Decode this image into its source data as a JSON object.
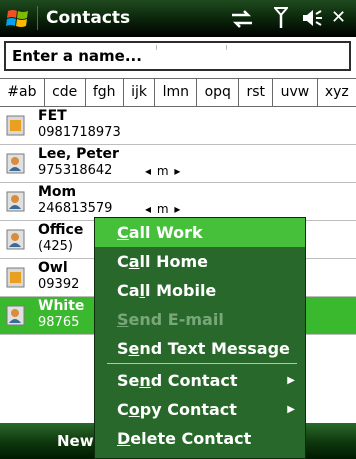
{
  "titlebar": {
    "title": "Contacts",
    "icons": [
      "sync-icon",
      "signal-icon",
      "volume-icon",
      "close-icon"
    ],
    "close_glyph": "✕"
  },
  "search": {
    "placeholder": "Enter a name..."
  },
  "tabs": [
    "#ab",
    "cde",
    "fgh",
    "ijk",
    "lmn",
    "opq",
    "rst",
    "uvw",
    "xyz"
  ],
  "contacts": [
    {
      "name": "FET",
      "phone": "0981718973",
      "icon": "sim-card-icon",
      "extra": "",
      "selected": false
    },
    {
      "name": "Lee, Peter",
      "phone": "975318642",
      "icon": "contact-card-icon",
      "extra": "◂ m ▸",
      "selected": false
    },
    {
      "name": "Mom",
      "phone": "246813579",
      "icon": "contact-card-icon",
      "extra": "◂ m ▸",
      "selected": false
    },
    {
      "name": "Office",
      "phone": "(425)",
      "icon": "contact-card-icon",
      "extra": "",
      "selected": false
    },
    {
      "name": "Owl",
      "phone": "09392",
      "icon": "sim-card-icon",
      "extra": "",
      "selected": false
    },
    {
      "name": "White",
      "phone": "98765",
      "icon": "contact-card-icon",
      "extra": "",
      "selected": true
    }
  ],
  "menu": {
    "items": [
      {
        "pre": "",
        "ul": "C",
        "post": "all Work",
        "state": "highlighted",
        "submenu": false
      },
      {
        "pre": "C",
        "ul": "a",
        "post": "ll Home",
        "state": "normal",
        "submenu": false
      },
      {
        "pre": "Ca",
        "ul": "l",
        "post": "l Mobile",
        "state": "normal",
        "submenu": false
      },
      {
        "pre": "",
        "ul": "S",
        "post": "end E-mail",
        "state": "disabled",
        "submenu": false
      },
      {
        "pre": "S",
        "ul": "e",
        "post": "nd Text Message",
        "state": "normal",
        "submenu": false
      },
      {
        "pre": "Se",
        "ul": "n",
        "post": "d Contact",
        "state": "normal",
        "submenu": true
      },
      {
        "pre": "C",
        "ul": "o",
        "post": "py Contact",
        "state": "normal",
        "submenu": true
      },
      {
        "pre": "",
        "ul": "D",
        "post": "elete Contact",
        "state": "normal",
        "submenu": false
      }
    ],
    "arrow": "▶"
  },
  "softkeys": {
    "left": "New"
  },
  "colors": {
    "selected_row": "#3ab92e",
    "menu_bg": "#28682a",
    "menu_highlight": "#46c03b"
  }
}
